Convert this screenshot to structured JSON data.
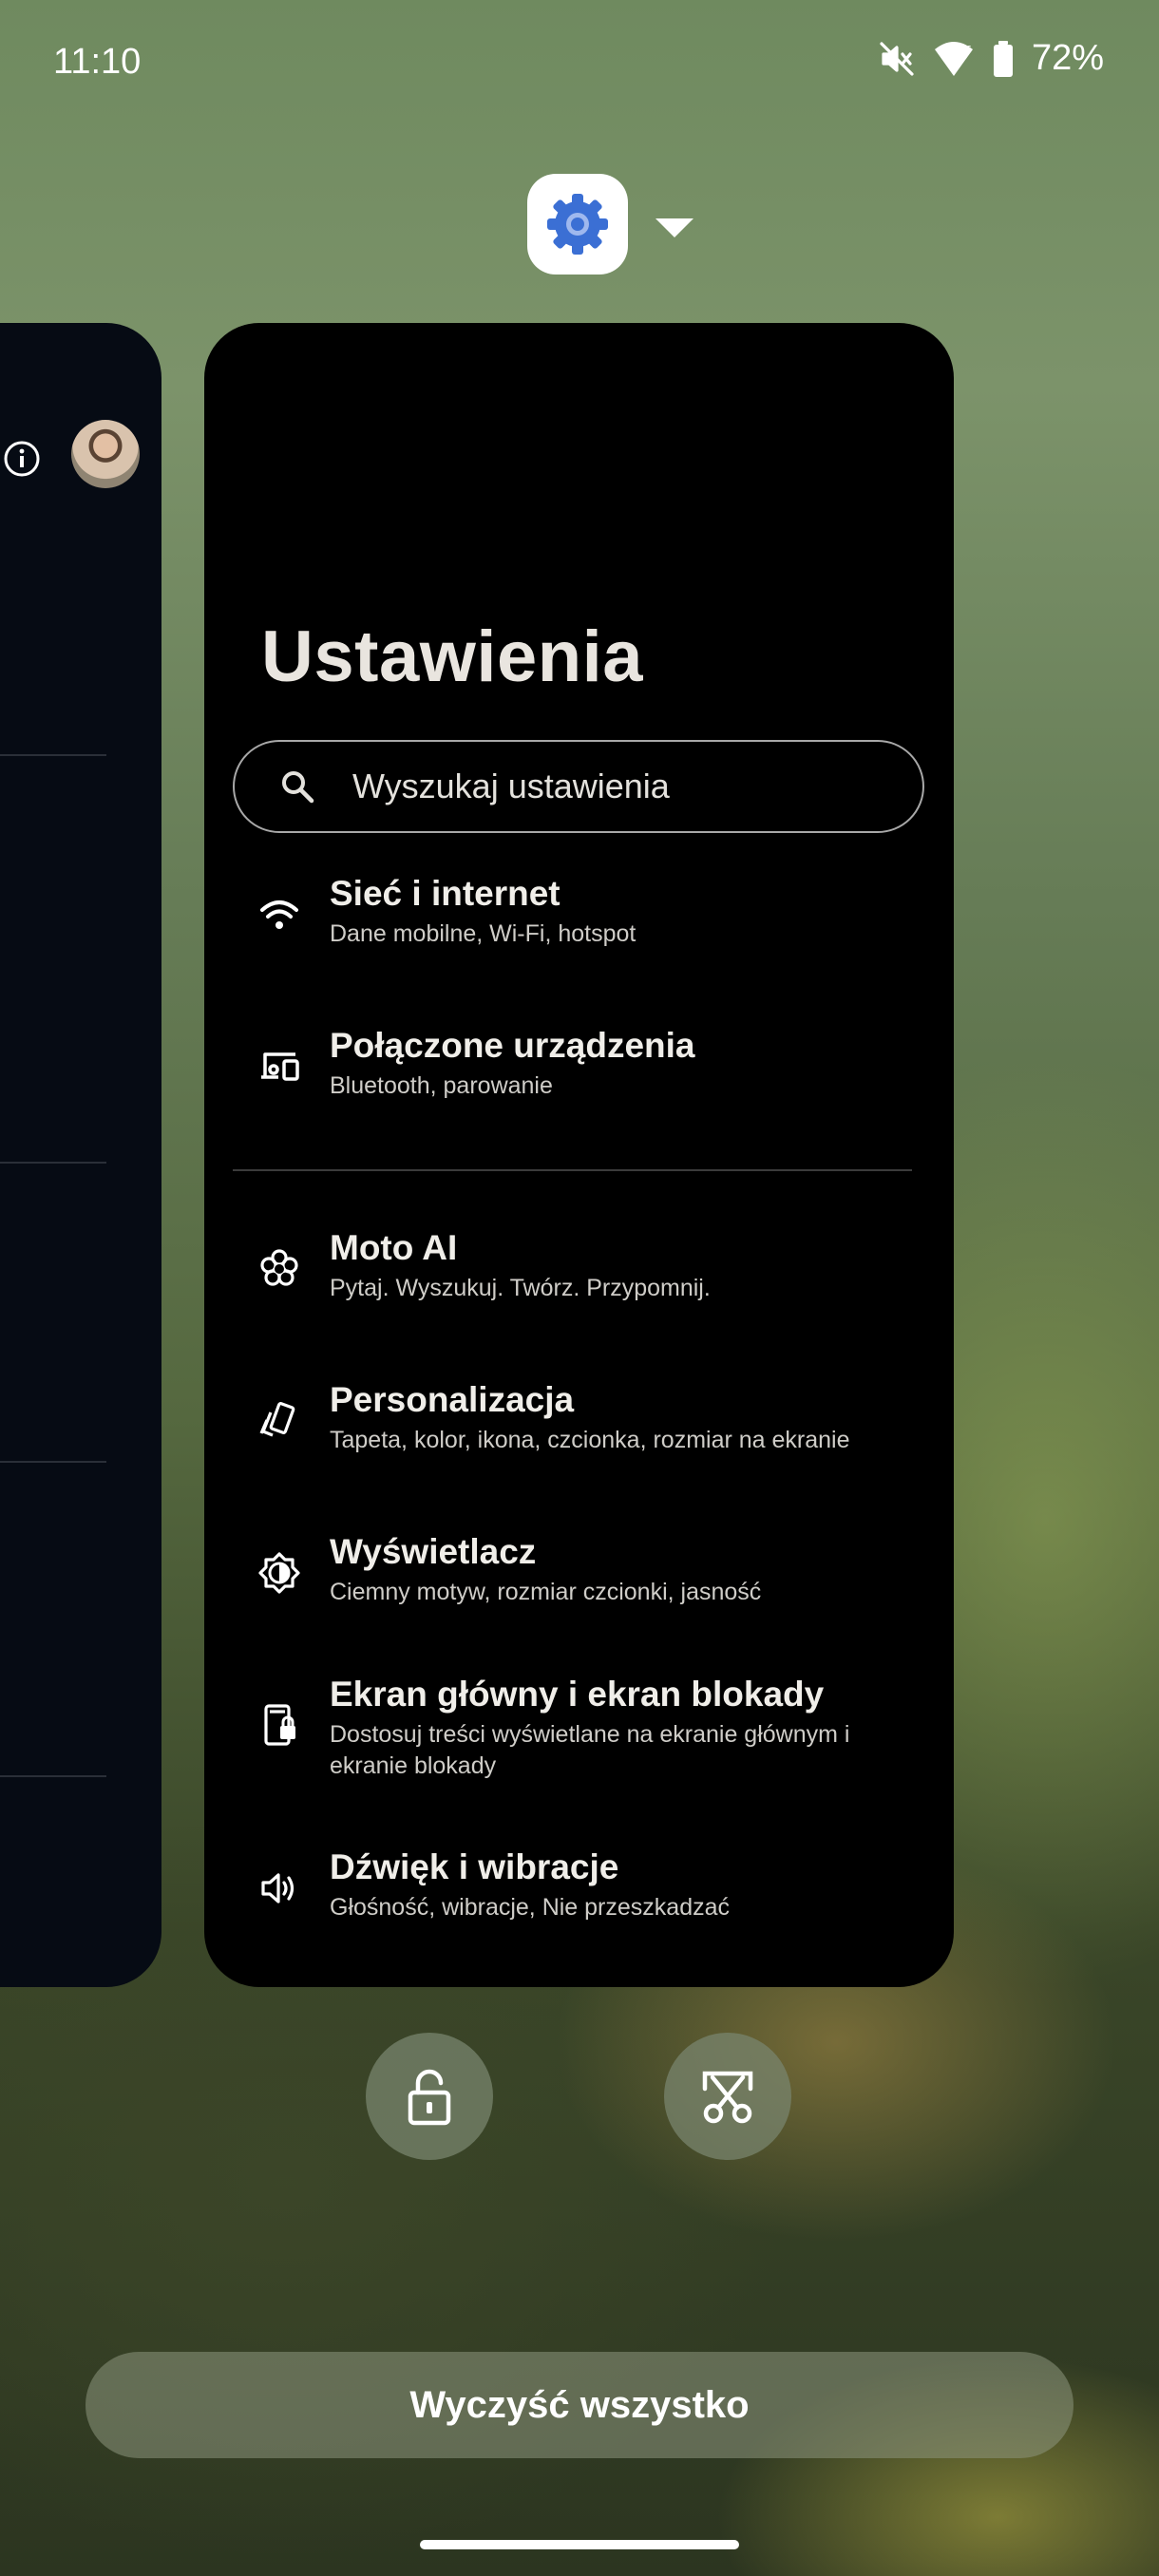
{
  "status_bar": {
    "time": "11:10",
    "battery": "72%",
    "icons": [
      "mute-icon",
      "wifi-icon",
      "battery-icon"
    ]
  },
  "recents": {
    "app_icon": "settings-gear-icon",
    "left_card": {
      "icons": [
        "info-icon",
        "avatar"
      ]
    },
    "main_card": {
      "title": "Ustawienia",
      "search_placeholder": "Wyszukaj ustawienia",
      "items": [
        {
          "icon": "wifi-icon",
          "title": "Sieć i internet",
          "subtitle": "Dane mobilne, Wi-Fi, hotspot"
        },
        {
          "icon": "connected-devices-icon",
          "title": "Połączone urządzenia",
          "subtitle": "Bluetooth, parowanie"
        },
        {
          "icon": "moto-ai-icon",
          "title": "Moto AI",
          "subtitle": "Pytaj. Wyszukuj. Twórz. Przypomnij."
        },
        {
          "icon": "personalize-icon",
          "title": "Personalizacja",
          "subtitle": "Tapeta, kolor, ikona, czcionka, rozmiar na ekranie"
        },
        {
          "icon": "display-icon",
          "title": "Wyświetlacz",
          "subtitle": "Ciemny motyw, rozmiar czcionki, jasność"
        },
        {
          "icon": "home-lock-screen-icon",
          "title": "Ekran główny i ekran blokady",
          "subtitle": "Dostosuj treści wyświetlane na ekranie głównym i ekranie blokady"
        },
        {
          "icon": "sound-icon",
          "title": "Dźwięk i wibracje",
          "subtitle": "Głośność, wibracje, Nie przeszkadzać"
        }
      ]
    },
    "actions": [
      "unlock-icon",
      "screenshot-select-icon"
    ],
    "clear_all": "Wyczyść wszystko"
  },
  "colors": {
    "card_background": "#000000",
    "text_primary": "#f0eee9",
    "app_icon_blue": "#3b6fd4"
  }
}
